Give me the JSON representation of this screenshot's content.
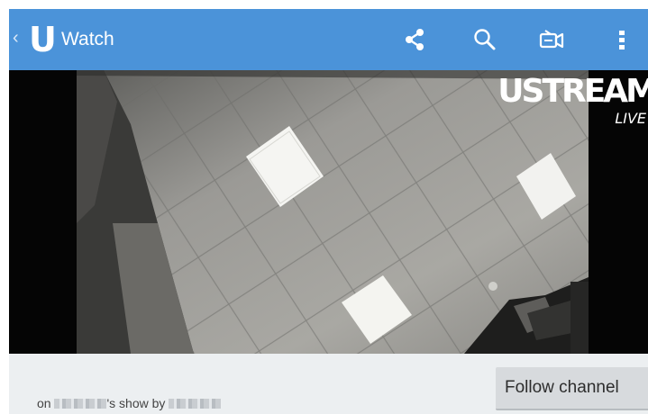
{
  "app": {
    "title": "Watch",
    "logo_letter": "U"
  },
  "action_bar": {
    "icons": [
      "share-icon",
      "search-icon",
      "broadcast-camera-icon",
      "overflow-menu-icon"
    ]
  },
  "video": {
    "brand": "USTREAM",
    "live_label": "LIVE"
  },
  "bottom": {
    "follow_label": "Follow channel",
    "byline_prefix": "on ",
    "byline_middle": "'s show by "
  },
  "colors": {
    "action_bar": "#4b93d9",
    "background": "#eceff1",
    "button": "#d7dadd"
  }
}
